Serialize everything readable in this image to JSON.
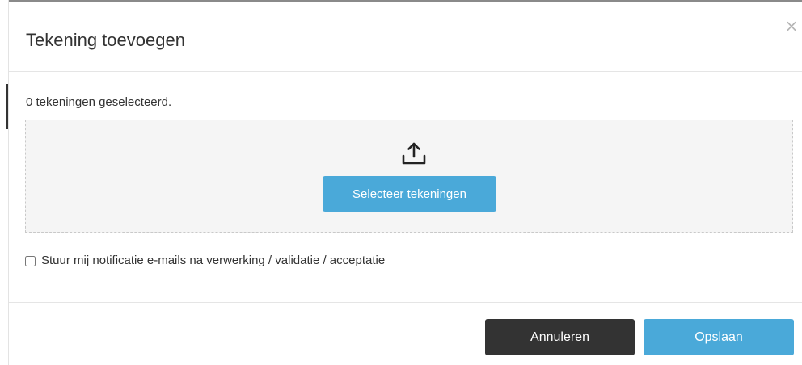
{
  "dialog": {
    "title": "Tekening toevoegen",
    "close_symbol": "×",
    "close_icon": "close-icon"
  },
  "body": {
    "selected_count_text": "0 tekeningen geselecteerd.",
    "dropzone": {
      "upload_icon": "upload-icon",
      "select_button_label": "Selecteer tekeningen"
    },
    "notification": {
      "label": "Stuur mij notificatie e-mails na verwerking / validatie / acceptatie",
      "checked": false
    }
  },
  "footer": {
    "cancel_label": "Annuleren",
    "save_label": "Opslaan"
  },
  "colors": {
    "primary": "#4aa9d9",
    "dark_button": "#333333",
    "dropzone_bg": "#f5f5f5"
  }
}
